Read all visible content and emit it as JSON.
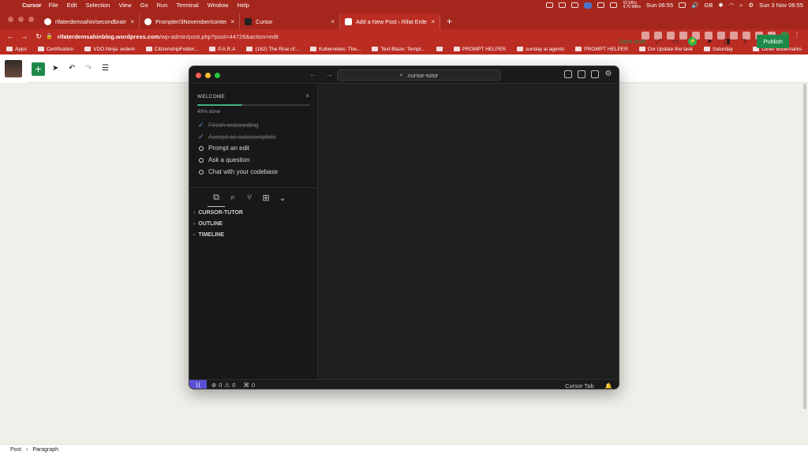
{
  "menubar": {
    "app_name": "Cursor",
    "items": [
      "File",
      "Edit",
      "Selection",
      "View",
      "Go",
      "Run",
      "Terminal",
      "Window",
      "Help"
    ],
    "net_up": "62 KB/s",
    "net_down": "4.70 MB/s",
    "time_short": "Sun 06:55",
    "keyboard": "GB",
    "datetime": "Sun 3 Nov  06:55"
  },
  "browser": {
    "tabs": [
      {
        "title": "rifaterdemsahin/secondbrain: t",
        "active": false
      },
      {
        "title": "Prompter/3November/content",
        "active": false
      },
      {
        "title": "Cursor",
        "active": false
      },
      {
        "title": "Add a New Post ‹ Rifat Erdem",
        "active": true
      }
    ],
    "url_host": "rifaterdemsahinblog.wordpress.com",
    "url_path": "/wp-admin/post.php?post=44726&action=edit",
    "bookmarks": [
      "Apps",
      "Certification",
      "VDO.Ninja: erdem",
      "CitizenshipFolder...",
      "P.A.R.A",
      "(182) The Rise of...",
      "Kubernetes: The...",
      "Text Blaze: Templ...",
      "",
      "PROMPT HELPER",
      "sunday ai agents",
      "PROMPT HELPER",
      "Ovi Update the task",
      "Saturday"
    ],
    "other_bookmarks": "Other Bookmarks"
  },
  "wordpress": {
    "save_draft": "Save draft",
    "publish": "Publish",
    "breadcrumb_post": "Post",
    "breadcrumb_block": "Paragraph"
  },
  "cursor": {
    "search_text": ".cursor-tutor",
    "welcome_title": "WELCOME",
    "progress_fraction": 0.4,
    "progress_text": "40% done",
    "tasks": [
      {
        "label": "Finish onboarding",
        "done": true
      },
      {
        "label": "Accept an autocomplete",
        "done": true
      },
      {
        "label": "Prompt an edit",
        "done": false
      },
      {
        "label": "Ask a question",
        "done": false
      },
      {
        "label": "Chat with your codebase",
        "done": false
      }
    ],
    "tree": [
      "CURSOR-TUTOR",
      "OUTLINE",
      "TIMELINE"
    ],
    "status": {
      "errors": "0",
      "warnings": "0",
      "ports": "0",
      "cursor_tab": "Cursor Tab"
    }
  },
  "colors": {
    "menubar": "#a5261c",
    "wp_green": "#1e8a4a",
    "cursor_bg": "#1f1f1f",
    "progress": "#3fb07f",
    "remote": "#5b4fd6"
  }
}
